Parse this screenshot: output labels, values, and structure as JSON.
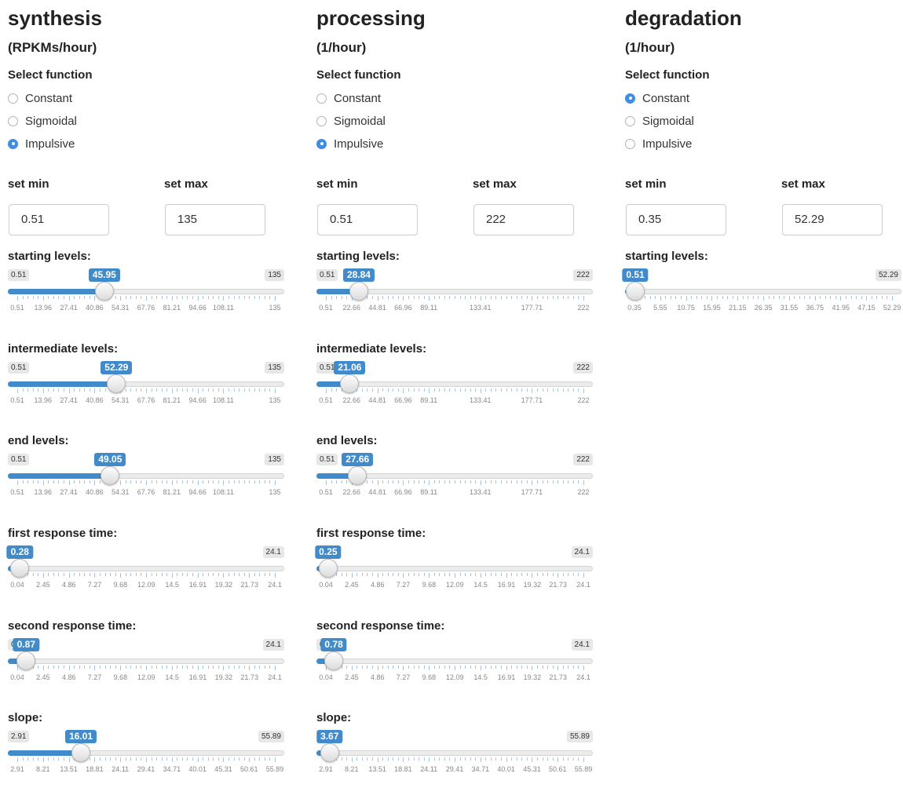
{
  "columns": [
    {
      "title": "synthesis",
      "unit": "(RPKMs/hour)",
      "select_label": "Select function",
      "options": [
        "Constant",
        "Sigmoidal",
        "Impulsive"
      ],
      "selected": "Impulsive",
      "set_min_label": "set min",
      "set_max_label": "set max",
      "min_value": "0.51",
      "max_value": "135",
      "sliders": [
        {
          "label": "starting levels:",
          "min": 0.51,
          "max": 135,
          "value": 45.95,
          "ticks": [
            "0.51",
            "13.96",
            "27.41",
            "40.86",
            "54.31",
            "67.76",
            "81.21",
            "94.66",
            "108.11",
            "135"
          ]
        },
        {
          "label": "intermediate levels:",
          "min": 0.51,
          "max": 135,
          "value": 52.29,
          "ticks": [
            "0.51",
            "13.96",
            "27.41",
            "40.86",
            "54.31",
            "67.76",
            "81.21",
            "94.66",
            "108.11",
            "135"
          ]
        },
        {
          "label": "end levels:",
          "min": 0.51,
          "max": 135,
          "value": 49.05,
          "ticks": [
            "0.51",
            "13.96",
            "27.41",
            "40.86",
            "54.31",
            "67.76",
            "81.21",
            "94.66",
            "108.11",
            "135"
          ]
        },
        {
          "label": "first response time:",
          "min": 0.04,
          "max": 24.1,
          "value": 0.28,
          "ticks": [
            "0.04",
            "2.45",
            "4.86",
            "7.27",
            "9.68",
            "12.09",
            "14.5",
            "16.91",
            "19.32",
            "21.73",
            "24.1"
          ]
        },
        {
          "label": "second response time:",
          "min": 0.04,
          "max": 24.1,
          "value": 0.87,
          "ticks": [
            "0.04",
            "2.45",
            "4.86",
            "7.27",
            "9.68",
            "12.09",
            "14.5",
            "16.91",
            "19.32",
            "21.73",
            "24.1"
          ]
        },
        {
          "label": "slope:",
          "min": 2.91,
          "max": 55.89,
          "value": 16.01,
          "ticks": [
            "2.91",
            "8.21",
            "13.51",
            "18.81",
            "24.11",
            "29.41",
            "34.71",
            "40.01",
            "45.31",
            "50.61",
            "55.89"
          ]
        }
      ]
    },
    {
      "title": "processing",
      "unit": "(1/hour)",
      "select_label": "Select function",
      "options": [
        "Constant",
        "Sigmoidal",
        "Impulsive"
      ],
      "selected": "Impulsive",
      "set_min_label": "set min",
      "set_max_label": "set max",
      "min_value": "0.51",
      "max_value": "222",
      "sliders": [
        {
          "label": "starting levels:",
          "min": 0.51,
          "max": 222,
          "value": 28.84,
          "ticks": [
            "0.51",
            "22.66",
            "44.81",
            "66.96",
            "89.11",
            "133.41",
            "177.71",
            "222"
          ]
        },
        {
          "label": "intermediate levels:",
          "min": 0.51,
          "max": 222,
          "value": 21.06,
          "ticks": [
            "0.51",
            "22.66",
            "44.81",
            "66.96",
            "89.11",
            "133.41",
            "177.71",
            "222"
          ]
        },
        {
          "label": "end levels:",
          "min": 0.51,
          "max": 222,
          "value": 27.66,
          "ticks": [
            "0.51",
            "22.66",
            "44.81",
            "66.96",
            "89.11",
            "133.41",
            "177.71",
            "222"
          ]
        },
        {
          "label": "first response time:",
          "min": 0.04,
          "max": 24.1,
          "value": 0.25,
          "ticks": [
            "0.04",
            "2.45",
            "4.86",
            "7.27",
            "9.68",
            "12.09",
            "14.5",
            "16.91",
            "19.32",
            "21.73",
            "24.1"
          ]
        },
        {
          "label": "second response time:",
          "min": 0.04,
          "max": 24.1,
          "value": 0.78,
          "ticks": [
            "0.04",
            "2.45",
            "4.86",
            "7.27",
            "9.68",
            "12.09",
            "14.5",
            "16.91",
            "19.32",
            "21.73",
            "24.1"
          ]
        },
        {
          "label": "slope:",
          "min": 2.91,
          "max": 55.89,
          "value": 3.67,
          "ticks": [
            "2.91",
            "8.21",
            "13.51",
            "18.81",
            "24.11",
            "29.41",
            "34.71",
            "40.01",
            "45.31",
            "50.61",
            "55.89"
          ]
        }
      ]
    },
    {
      "title": "degradation",
      "unit": "(1/hour)",
      "select_label": "Select function",
      "options": [
        "Constant",
        "Sigmoidal",
        "Impulsive"
      ],
      "selected": "Constant",
      "set_min_label": "set min",
      "set_max_label": "set max",
      "min_value": "0.35",
      "max_value": "52.29",
      "sliders": [
        {
          "label": "starting levels:",
          "min": 0.35,
          "max": 52.29,
          "value": 0.51,
          "ticks": [
            "0.35",
            "5.55",
            "10.75",
            "15.95",
            "21.15",
            "26.35",
            "31.55",
            "36.75",
            "41.95",
            "47.15",
            "52.29"
          ]
        }
      ]
    }
  ]
}
